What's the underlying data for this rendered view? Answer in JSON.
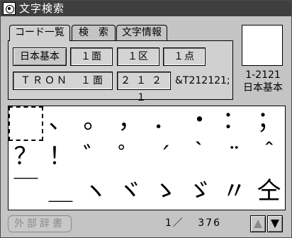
{
  "window": {
    "title": "文字検索"
  },
  "tabs": [
    {
      "label": "コード一覧"
    },
    {
      "label": "検　索"
    },
    {
      "label": "文字情報"
    }
  ],
  "panel": {
    "charset_button": "日本基本",
    "men": "１面",
    "ku": "１区",
    "ten": "１点",
    "tron_field": "ＴＲＯＮ　１面",
    "jis_code": "２１２１",
    "entity_ref": "&T212121;"
  },
  "preview": {
    "code": "1-2121",
    "charset": "日本基本"
  },
  "glyph_grid": {
    "row1": [
      "",
      "、",
      "。",
      "，",
      "．",
      "・",
      "：",
      "；"
    ],
    "row2": [
      "？",
      "！",
      "゛",
      "゜",
      "´",
      "｀",
      "¨",
      "＾"
    ],
    "row3": [
      "￣",
      "＿",
      "ヽ",
      "ヾ",
      "ゝ",
      "ゞ",
      "〃",
      "仝"
    ]
  },
  "bottom": {
    "external_dict_button": "外部辞書",
    "page": "1／",
    "total": "376"
  },
  "icons": {
    "up_arrow": "up-arrow-icon",
    "down_arrow": "down-arrow-icon",
    "window_icon": "window-icon"
  },
  "colors": {
    "titlebar": "#3f3f3f",
    "window_bg": "#c4c4c4",
    "disabled_text": "#8c8c8c"
  }
}
